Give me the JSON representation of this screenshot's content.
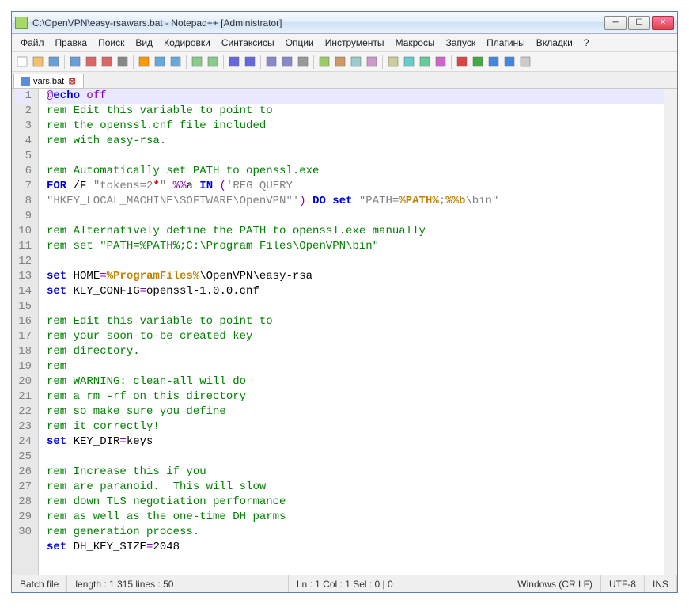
{
  "window": {
    "title": "C:\\OpenVPN\\easy-rsa\\vars.bat - Notepad++ [Administrator]"
  },
  "menu": [
    "Файл",
    "Правка",
    "Поиск",
    "Вид",
    "Кодировки",
    "Синтаксисы",
    "Опции",
    "Инструменты",
    "Макросы",
    "Запуск",
    "Плагины",
    "Вкладки",
    "?"
  ],
  "tab": {
    "label": "vars.bat"
  },
  "code_lines": [
    {
      "n": 1,
      "tokens": [
        {
          "t": "@",
          "c": "kw-oper"
        },
        {
          "t": "echo ",
          "c": "kw-blue"
        },
        {
          "t": "off",
          "c": "kw-oper"
        }
      ]
    },
    {
      "n": 2,
      "tokens": [
        {
          "t": "rem Edit this variable to point to",
          "c": "kw-rem"
        }
      ]
    },
    {
      "n": 3,
      "tokens": [
        {
          "t": "rem the openssl.cnf file included",
          "c": "kw-rem"
        }
      ]
    },
    {
      "n": 4,
      "tokens": [
        {
          "t": "rem with easy-rsa.",
          "c": "kw-rem"
        }
      ]
    },
    {
      "n": 5,
      "tokens": []
    },
    {
      "n": 6,
      "tokens": [
        {
          "t": "rem Automatically set PATH to openssl.exe",
          "c": "kw-rem"
        }
      ]
    },
    {
      "n": 7,
      "tokens": [
        {
          "t": "FOR ",
          "c": "kw-blue"
        },
        {
          "t": "/F ",
          "c": ""
        },
        {
          "t": "\"tokens=2",
          "c": "str"
        },
        {
          "t": "*",
          "c": "star"
        },
        {
          "t": "\" ",
          "c": "str"
        },
        {
          "t": "%%",
          "c": "kw-oper"
        },
        {
          "t": "a ",
          "c": ""
        },
        {
          "t": "IN ",
          "c": "kw-blue"
        },
        {
          "t": "(",
          "c": "kw-oper"
        },
        {
          "t": "'REG QUERY \"HKEY_LOCAL_MACHINE\\SOFTWARE\\OpenVPN\"'",
          "c": "str"
        },
        {
          "t": ")",
          "c": "kw-oper"
        },
        {
          "t": " ",
          "c": ""
        },
        {
          "t": "DO ",
          "c": "kw-do"
        },
        {
          "t": "set ",
          "c": "kw-set"
        },
        {
          "t": "\"PATH=",
          "c": "str"
        },
        {
          "t": "%PATH%",
          "c": "var"
        },
        {
          "t": ";",
          "c": "str"
        },
        {
          "t": "%%b",
          "c": "var"
        },
        {
          "t": "\\bin\"",
          "c": "str"
        }
      ]
    },
    {
      "n": 8,
      "tokens": []
    },
    {
      "n": 9,
      "tokens": [
        {
          "t": "rem Alternatively define the PATH to openssl.exe manually",
          "c": "kw-rem"
        }
      ]
    },
    {
      "n": 10,
      "tokens": [
        {
          "t": "rem set \"PATH=%PATH%;C:\\Program Files\\OpenVPN\\bin\"",
          "c": "kw-rem"
        }
      ]
    },
    {
      "n": 11,
      "tokens": []
    },
    {
      "n": 12,
      "tokens": [
        {
          "t": "set ",
          "c": "kw-set"
        },
        {
          "t": "HOME",
          "c": ""
        },
        {
          "t": "=",
          "c": "kw-oper"
        },
        {
          "t": "%ProgramFiles%",
          "c": "var"
        },
        {
          "t": "\\OpenVPN\\easy-rsa",
          "c": ""
        }
      ]
    },
    {
      "n": 13,
      "tokens": [
        {
          "t": "set ",
          "c": "kw-set"
        },
        {
          "t": "KEY_CONFIG",
          "c": ""
        },
        {
          "t": "=",
          "c": "kw-oper"
        },
        {
          "t": "openssl-1.0.0.cnf",
          "c": ""
        }
      ]
    },
    {
      "n": 14,
      "tokens": []
    },
    {
      "n": 15,
      "tokens": [
        {
          "t": "rem Edit this variable to point to",
          "c": "kw-rem"
        }
      ]
    },
    {
      "n": 16,
      "tokens": [
        {
          "t": "rem your soon-to-be-created key",
          "c": "kw-rem"
        }
      ]
    },
    {
      "n": 17,
      "tokens": [
        {
          "t": "rem directory.",
          "c": "kw-rem"
        }
      ]
    },
    {
      "n": 18,
      "tokens": [
        {
          "t": "rem",
          "c": "kw-rem"
        }
      ]
    },
    {
      "n": 19,
      "tokens": [
        {
          "t": "rem WARNING: clean-all will do",
          "c": "kw-rem"
        }
      ]
    },
    {
      "n": 20,
      "tokens": [
        {
          "t": "rem a rm -rf on this directory",
          "c": "kw-rem"
        }
      ]
    },
    {
      "n": 21,
      "tokens": [
        {
          "t": "rem so make sure you define",
          "c": "kw-rem"
        }
      ]
    },
    {
      "n": 22,
      "tokens": [
        {
          "t": "rem it correctly!",
          "c": "kw-rem"
        }
      ]
    },
    {
      "n": 23,
      "tokens": [
        {
          "t": "set ",
          "c": "kw-set"
        },
        {
          "t": "KEY_DIR",
          "c": ""
        },
        {
          "t": "=",
          "c": "kw-oper"
        },
        {
          "t": "keys",
          "c": ""
        }
      ]
    },
    {
      "n": 24,
      "tokens": []
    },
    {
      "n": 25,
      "tokens": [
        {
          "t": "rem Increase this if you",
          "c": "kw-rem"
        }
      ]
    },
    {
      "n": 26,
      "tokens": [
        {
          "t": "rem are paranoid.  This will slow",
          "c": "kw-rem"
        }
      ]
    },
    {
      "n": 27,
      "tokens": [
        {
          "t": "rem down TLS negotiation performance",
          "c": "kw-rem"
        }
      ]
    },
    {
      "n": 28,
      "tokens": [
        {
          "t": "rem as well as the one-time DH parms",
          "c": "kw-rem"
        }
      ]
    },
    {
      "n": 29,
      "tokens": [
        {
          "t": "rem generation process.",
          "c": "kw-rem"
        }
      ]
    },
    {
      "n": 30,
      "tokens": [
        {
          "t": "set ",
          "c": "kw-set"
        },
        {
          "t": "DH_KEY_SIZE",
          "c": ""
        },
        {
          "t": "=",
          "c": "kw-oper"
        },
        {
          "t": "2048",
          "c": ""
        }
      ]
    }
  ],
  "status": {
    "filetype": "Batch file",
    "length": "length : 1 315    lines : 50",
    "pos": "Ln : 1    Col : 1    Sel : 0 | 0",
    "eol": "Windows (CR LF)",
    "encoding": "UTF-8",
    "mode": "INS"
  },
  "toolbar_icons": [
    "new",
    "open",
    "save",
    "save-all",
    "close",
    "close-all",
    "print",
    "cut",
    "copy",
    "paste",
    "undo",
    "redo",
    "find",
    "replace",
    "zoom-in",
    "zoom-out",
    "sync",
    "wrap",
    "all-chars",
    "indent-guide",
    "lang",
    "monitor",
    "doc-map",
    "func-list",
    "folder",
    "record-macro",
    "stop-macro",
    "play-macro",
    "play-multi",
    "save-macro"
  ]
}
